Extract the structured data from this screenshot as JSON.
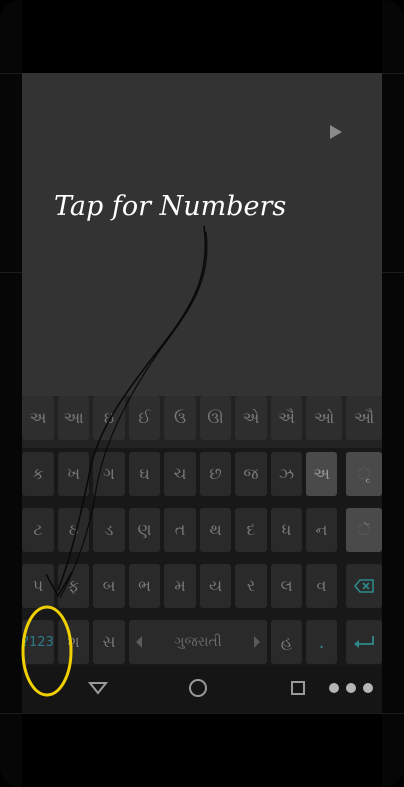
{
  "tutorial": {
    "hint": "Tap for Numbers"
  },
  "keyboard": {
    "vowel_row": [
      "અ",
      "આ",
      "ઇ",
      "ઈ",
      "ઉ",
      "ઊ",
      "એ",
      "ઐ",
      "ઓ",
      "ઔ"
    ],
    "row1": [
      "ક",
      "ખ",
      "ગ",
      "ઘ",
      "ચ",
      "છ",
      "જ",
      "ઝ",
      "અ",
      "ૃ"
    ],
    "row2": [
      "ટ",
      "ઠ",
      "ડ",
      "ણ",
      "ત",
      "થ",
      "દ",
      "ધ",
      "ન",
      "ૅ"
    ],
    "row3": [
      "પ",
      "ફ",
      "બ",
      "ભ",
      "મ",
      "ય",
      "ર",
      "લ",
      "વ"
    ],
    "bottom": {
      "numbers_key": "?123",
      "key2": "શ",
      "key3": "સ",
      "language": "ગુજરાતી",
      "key_h": "હ",
      "period": "."
    }
  },
  "colors": {
    "annotation_circle": "#f0d000",
    "keyboard_bg": "#181818"
  },
  "icons": [
    "play-icon",
    "backspace-icon",
    "enter-icon",
    "back-icon",
    "home-icon",
    "recents-icon",
    "more-icon"
  ]
}
